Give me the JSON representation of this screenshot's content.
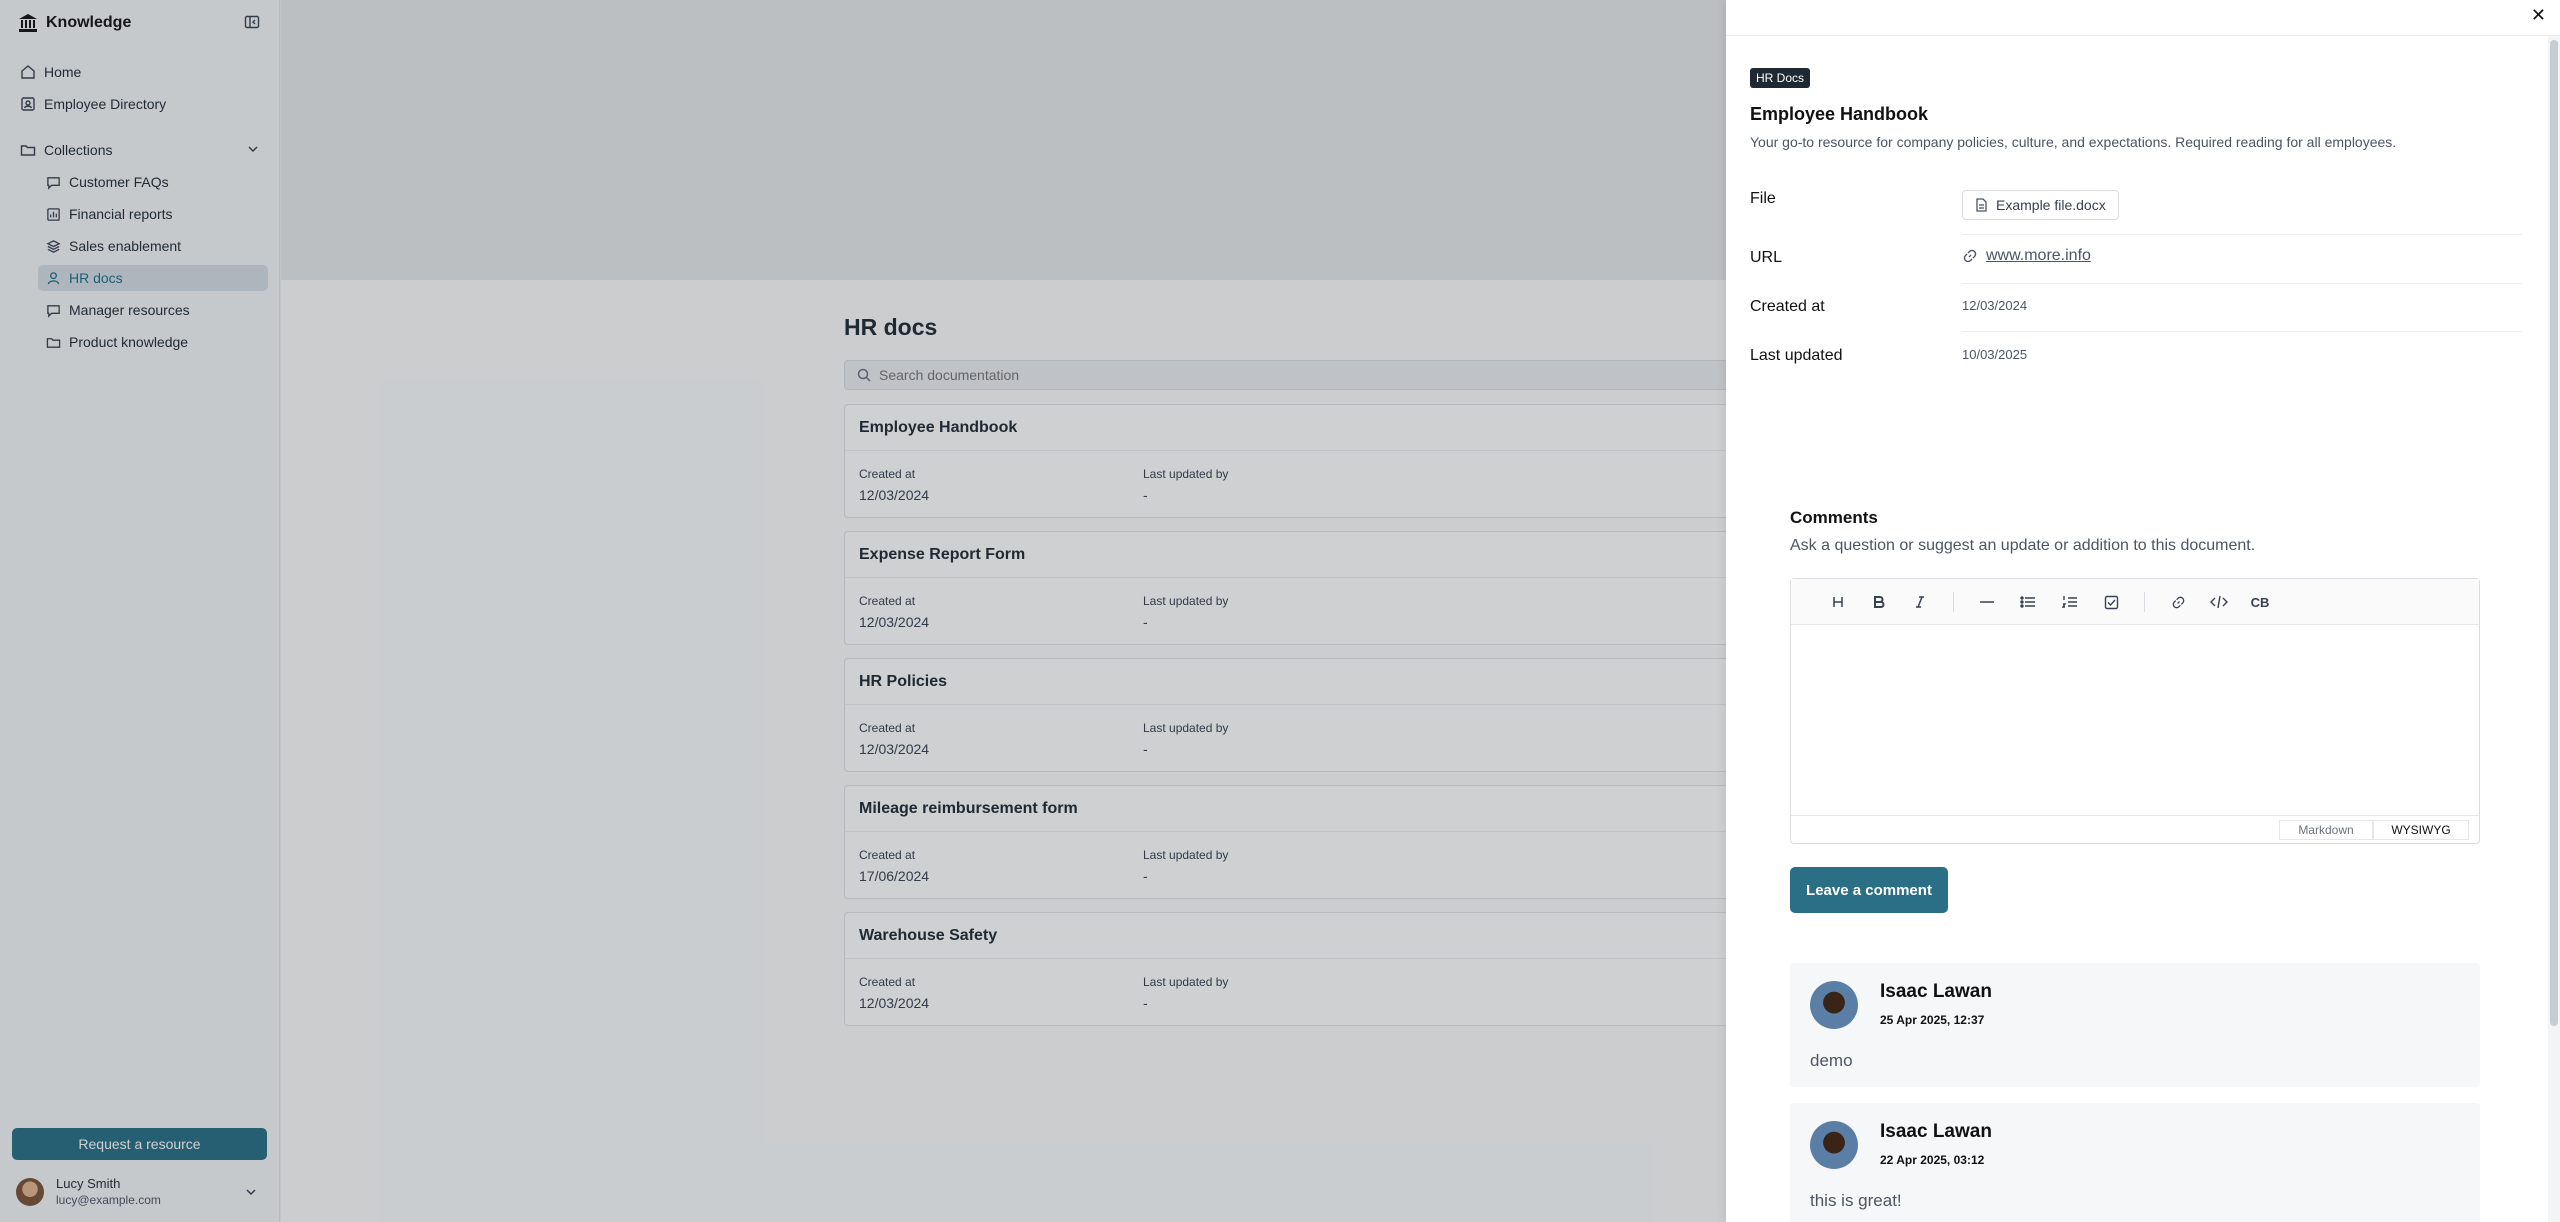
{
  "sidebar": {
    "brand": "Knowledge",
    "nav": [
      {
        "label": "Home",
        "icon": "home-icon"
      },
      {
        "label": "Employee Directory",
        "icon": "directory-icon"
      }
    ],
    "collections_label": "Collections",
    "collections": [
      {
        "label": "Customer FAQs",
        "icon": "chat-icon"
      },
      {
        "label": "Financial reports",
        "icon": "report-icon"
      },
      {
        "label": "Sales enablement",
        "icon": "layers-icon"
      },
      {
        "label": "HR docs",
        "icon": "person-icon",
        "active": true
      },
      {
        "label": "Manager resources",
        "icon": "chat-icon"
      },
      {
        "label": "Product knowledge",
        "icon": "folder-icon"
      }
    ],
    "request_button": "Request a resource",
    "user": {
      "name": "Lucy Smith",
      "email": "lucy@example.com"
    }
  },
  "main": {
    "title": "HR docs",
    "search_placeholder": "Search documentation",
    "meta_labels": {
      "created": "Created at",
      "updated_by": "Last updated by"
    },
    "docs": [
      {
        "title": "Employee Handbook",
        "created": "12/03/2024",
        "updated_by": "-"
      },
      {
        "title": "Expense Report Form",
        "created": "12/03/2024",
        "updated_by": "-"
      },
      {
        "title": "HR Policies",
        "created": "12/03/2024",
        "updated_by": "-"
      },
      {
        "title": "Mileage reimbursement form",
        "created": "17/06/2024",
        "updated_by": "-"
      },
      {
        "title": "Warehouse Safety",
        "created": "12/03/2024",
        "updated_by": "-"
      }
    ]
  },
  "drawer": {
    "close": "✕",
    "tag": "HR Docs",
    "title": "Employee Handbook",
    "description": "Your go-to resource for company policies, culture, and expectations. Required reading for all employees.",
    "props": {
      "file_label": "File",
      "file_value": "Example file.docx",
      "url_label": "URL",
      "url_value": "www.more.info",
      "created_label": "Created at",
      "created_value": "12/03/2024",
      "updated_label": "Last updated",
      "updated_value": "10/03/2025"
    },
    "comments_title": "Comments",
    "comments_subtitle": "Ask a question or suggest an update or addition to this document.",
    "editor": {
      "toolbar": [
        "heading-icon",
        "bold-icon",
        "italic-icon",
        "divider-icon",
        "bullet-list-icon",
        "ordered-list-icon",
        "checklist-icon",
        "link-icon",
        "code-icon",
        "codeblock-icon"
      ],
      "mode_markdown": "Markdown",
      "mode_wysiwyg": "WYSIWYG"
    },
    "submit_label": "Leave a comment",
    "comments": [
      {
        "author": "Isaac Lawan",
        "date": "25 Apr 2025, 12:37",
        "text": "demo"
      },
      {
        "author": "Isaac Lawan",
        "date": "22 Apr 2025, 03:12",
        "text": "this is great!"
      }
    ]
  },
  "colors": {
    "accent": "#2a6f85",
    "active_bg": "#d7dee4"
  }
}
